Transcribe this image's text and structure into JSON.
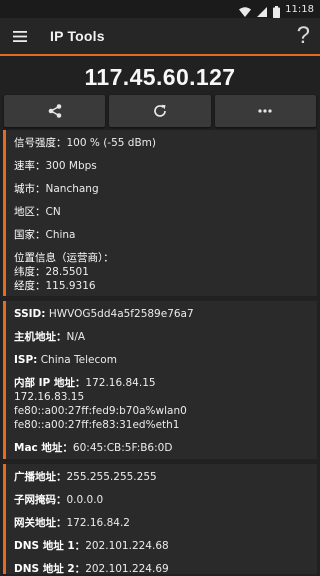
{
  "status_bar": {
    "time": "11:18"
  },
  "app_bar": {
    "title": "IP Tools",
    "help": "?"
  },
  "ip_address": "117.45.60.127",
  "toolbar": {
    "share_icon": "share-icon",
    "refresh_icon": "refresh-icon",
    "more_icon": "more-icon"
  },
  "card1": {
    "signal_label": "信号强度：",
    "signal_value": "100 % (-55 dBm)",
    "speed_label": "速率：",
    "speed_value": "300 Mbps",
    "city_label": "城市：",
    "city_value": "Nanchang",
    "region_label": "地区：",
    "region_value": "CN",
    "country_label": "国家：",
    "country_value": "China",
    "location_label": "位置信息（运营商）：",
    "lat_label": "纬度：",
    "lat_value": "28.5501",
    "lon_label": "经度：",
    "lon_value": "115.9316"
  },
  "card2": {
    "ssid_label": "SSID:",
    "ssid_value": "HWVOG5dd4a5f2589e76a7",
    "host_label": "主机地址：",
    "host_value": "N/A",
    "isp_label": "ISP:",
    "isp_value": "China Telecom",
    "internal_ip_label": "内部 IP 地址：",
    "internal_ip_values": [
      "172.16.84.15",
      "172.16.83.15",
      "fe80::a00:27ff:fed9:b70a%wlan0",
      "fe80::a00:27ff:fe83:31ed%eth1"
    ],
    "mac_label": "Mac 地址：",
    "mac_value": "60:45:CB:5F:B6:0D"
  },
  "card3": {
    "broadcast_label": "广播地址：",
    "broadcast_value": "255.255.255.255",
    "subnet_label": "子网掩码：",
    "subnet_value": "0.0.0.0",
    "gateway_label": "网关地址：",
    "gateway_value": "172.16.84.2",
    "dns1_label": "DNS 地址 1：",
    "dns1_value": "202.101.224.68",
    "dns2_label": "DNS 地址 2：",
    "dns2_value": "202.101.224.69"
  }
}
